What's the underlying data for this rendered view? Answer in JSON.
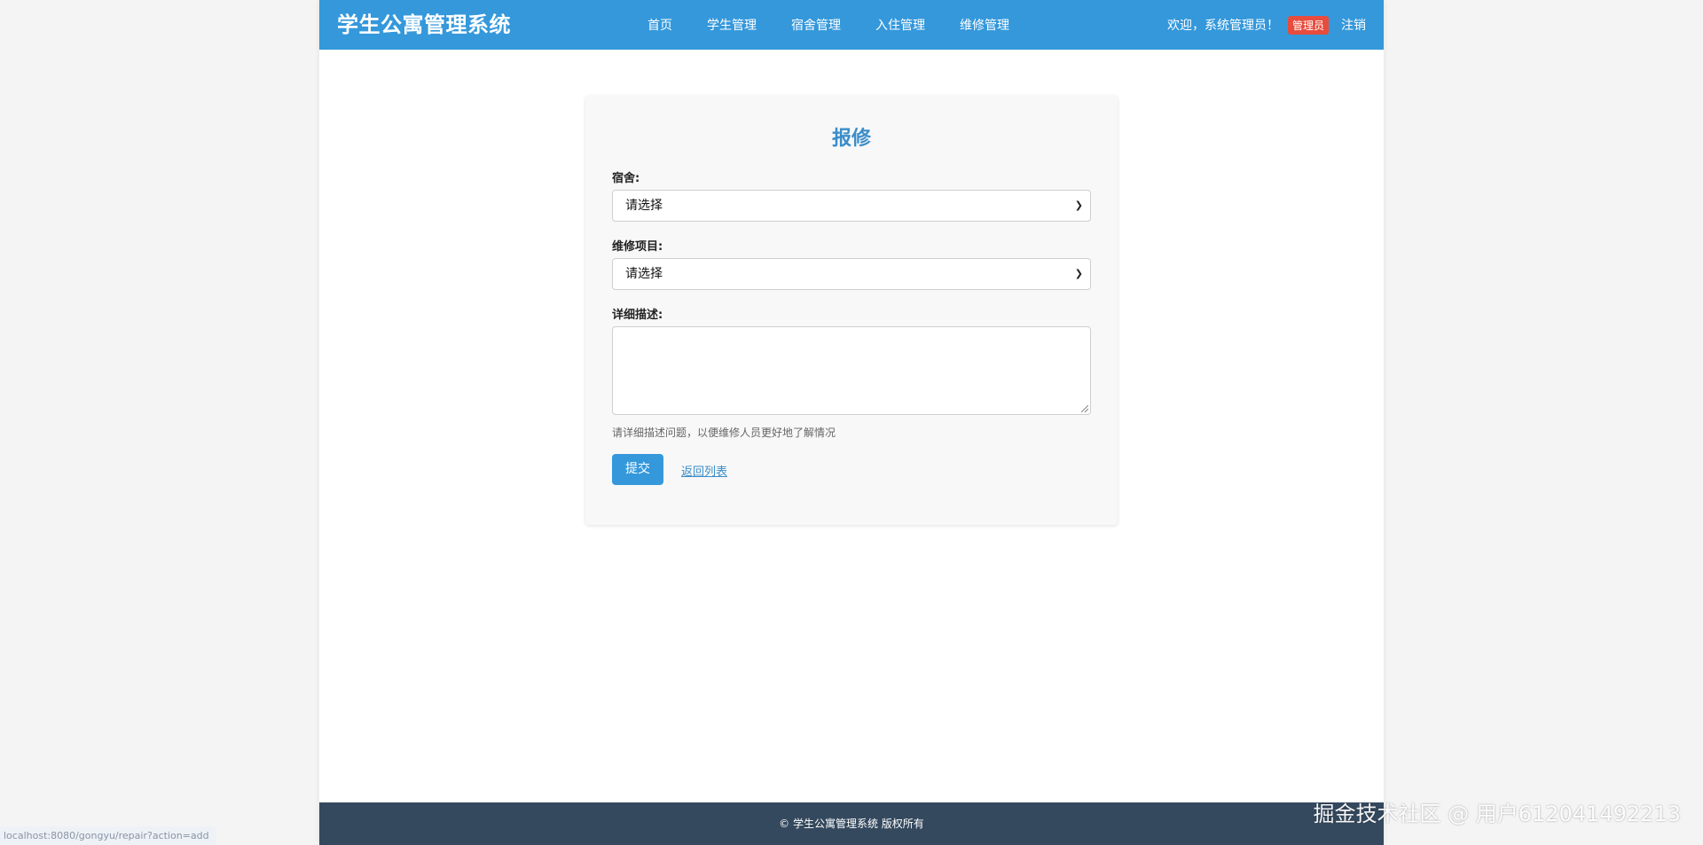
{
  "header": {
    "brand": "学生公寓管理系统",
    "nav": [
      "首页",
      "学生管理",
      "宿舍管理",
      "入住管理",
      "维修管理"
    ],
    "welcome": "欢迎，系统管理员！",
    "role_badge": "管理员",
    "logout": "注销",
    "colors": {
      "header_bg": "#3498db",
      "badge_bg": "#e74c3c"
    }
  },
  "form": {
    "title": "报修",
    "dorm_label": "宿舍:",
    "dorm_value": "请选择",
    "item_label": "维修项目:",
    "item_value": "请选择",
    "desc_label": "详细描述:",
    "desc_value": "",
    "hint": "请详细描述问题，以便维修人员更好地了解情况",
    "submit": "提交",
    "back": "返回列表"
  },
  "footer": {
    "text": "© 学生公寓管理系统 版权所有",
    "bg": "#34495e"
  },
  "status_bar": {
    "url": "localhost:8080/gongyu/repair?action=add"
  },
  "watermark": "掘金技术社区 @ 用户612041492213"
}
